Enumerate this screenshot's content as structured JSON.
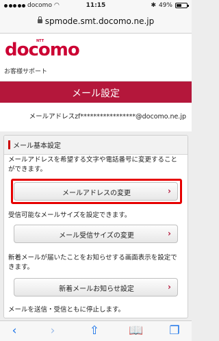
{
  "status_bar": {
    "carrier": "docomo",
    "time": "11:15",
    "battery_percent": "49%",
    "battery_level": 0.49
  },
  "browser": {
    "url": "spmode.smt.docomo.ne.jp"
  },
  "header": {
    "logo_small": "NTT",
    "logo": "docomo"
  },
  "nav": {
    "support_label": "お客様サポート"
  },
  "page": {
    "title": "メール設定",
    "mail_address": "メールアドレスzf*****************@docomo.ne.jp"
  },
  "section": {
    "title": "メール基本設定",
    "items": [
      {
        "description": "メールアドレスを希望する文字や電話番号に変更することができます。",
        "button": "メールアドレスの変更"
      },
      {
        "description": "受信可能なメールサイズを設定できます。",
        "button": "メール受信サイズの変更"
      },
      {
        "description": "新着メールが届いたことをお知らせする画面表示を設定できます。",
        "button": "新着メールお知らせ設定"
      },
      {
        "description": "メールを送信・受信ともに停止します。"
      }
    ]
  },
  "toolbar": {
    "back": "‹",
    "forward": "›",
    "share": "⇧",
    "bookmarks": "📖",
    "tabs": "❐"
  },
  "colors": {
    "brand": "#cc0033",
    "banner": "#b4173b",
    "highlight": "#e60000",
    "ios_blue": "#1a73e8"
  }
}
